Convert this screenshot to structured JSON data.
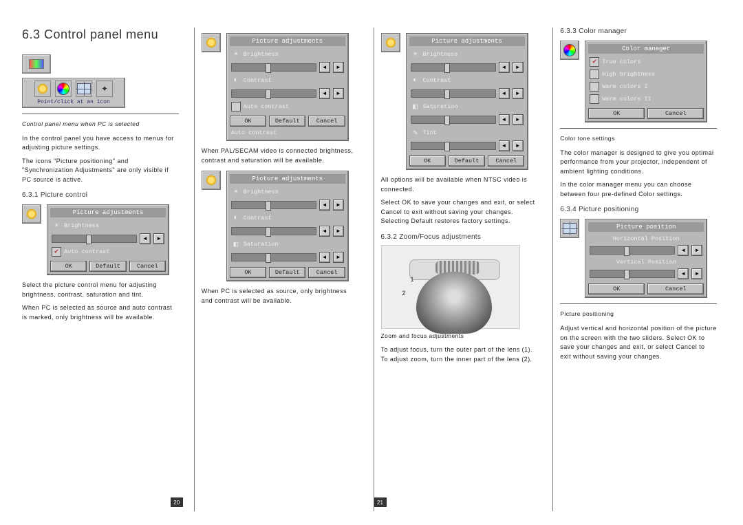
{
  "heading": "6.3  Control panel menu",
  "toolbar": {
    "label": "Point/click at an icon",
    "icons": [
      "sun",
      "color",
      "position",
      "sync"
    ]
  },
  "caption_cp": "Control panel menu when PC is selected",
  "para_cp1": "In the control panel you have access to menus for adjusting picture settings.",
  "para_cp2": "The icons \"Picture positioning\" and \"Synchronization Adjustments\" are only visible if PC source is active.",
  "sec_6_3_1": "6.3.1 Picture control",
  "dlg_pic_adj": {
    "title": "Picture adjustments",
    "brightness": "Brightness",
    "contrast": "Contrast",
    "saturation": "Saturation",
    "tint": "Tint",
    "auto_contrast": "Auto contrast",
    "ok": "OK",
    "default": "Default",
    "cancel": "Cancel"
  },
  "para_pc1": "Select the picture control menu for adjusting brightness, contrast, saturation and tint.",
  "para_pc2": "When PC is selected as source and auto contrast is marked, only brightness will be available.",
  "para_col2a": "When PAL/SECAM video is connected brightness, contrast and saturation will be available.",
  "para_col2b": "When PC is selected as source, only brightness and contrast will be available.",
  "para_col3a": "All options will be available when NTSC video is connected.",
  "para_col3b": "Select OK to save your changes and exit, or select Cancel to exit without saving your changes. Selecting Default restores factory settings.",
  "sec_6_3_2": "6.3.2 Zoom/Focus adjustments",
  "caption_zoom": "Zoom and focus adjustments",
  "para_zoom": "To adjust focus, turn the outer part of the lens (1). To adjust zoom, turn the inner part of the lens (2).",
  "lens_labels": {
    "one": "1",
    "two": "2"
  },
  "sec_6_3_3": "6.3.3 Color manager",
  "dlg_color": {
    "title": "Color manager",
    "opt1": "True colors",
    "opt2": "High brightness",
    "opt3": "Warm colors I",
    "opt4": "Warm colors II",
    "ok": "OK",
    "cancel": "Cancel"
  },
  "caption_color": "Color tone settings",
  "para_color1": "The color manager is designed to give you optimal performance from your projector, independent of ambient lighting conditions.",
  "para_color2": "In the color manager menu you can choose between four pre-defined Color settings.",
  "sec_6_3_4": "6.3.4 Picture positioning",
  "dlg_pos": {
    "title": "Picture position",
    "h": "Horizontal Position",
    "v": "Vertical Position",
    "ok": "OK",
    "cancel": "Cancel"
  },
  "caption_pos": "Picture positioning",
  "para_pos": "Adjust vertical and horizontal position of the picture on the screen with the two sliders. Select OK to save your changes and exit, or select Cancel to exit without saving your changes.",
  "pages": {
    "left": "20",
    "right": "21"
  }
}
